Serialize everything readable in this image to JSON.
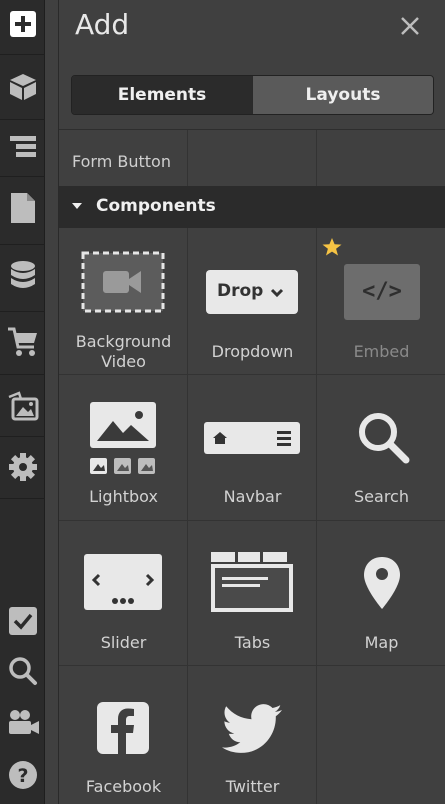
{
  "rail": {
    "items": [
      {
        "icon": "plus-square-icon"
      },
      {
        "icon": "box-icon"
      },
      {
        "icon": "navigator-icon"
      },
      {
        "icon": "page-icon"
      },
      {
        "icon": "database-icon"
      },
      {
        "icon": "cart-icon"
      },
      {
        "icon": "images-icon"
      },
      {
        "icon": "gear-icon"
      },
      {
        "icon": "checkbox-icon"
      },
      {
        "icon": "search-icon"
      },
      {
        "icon": "video-camera-icon"
      },
      {
        "icon": "help-icon"
      }
    ]
  },
  "panel": {
    "title": "Add",
    "close_icon": "close-icon",
    "tabs": [
      {
        "label": "Elements",
        "active": true
      },
      {
        "label": "Layouts",
        "active": false
      }
    ],
    "form_button_label": "Form Button",
    "section_title": "Components",
    "components": [
      {
        "label_line1": "Background",
        "label_line2": "Video",
        "icon": "background-video-icon"
      },
      {
        "label": "Dropdown",
        "icon": "dropdown-icon",
        "icon_text": "Drop"
      },
      {
        "label": "Embed",
        "icon": "embed-icon",
        "icon_text": "</>",
        "badge": "★"
      },
      {
        "label": "Lightbox",
        "icon": "lightbox-icon"
      },
      {
        "label": "Navbar",
        "icon": "navbar-icon"
      },
      {
        "label": "Search",
        "icon": "search-icon"
      },
      {
        "label": "Slider",
        "icon": "slider-icon"
      },
      {
        "label": "Tabs",
        "icon": "tabs-icon"
      },
      {
        "label": "Map",
        "icon": "map-pin-icon"
      },
      {
        "label": "Facebook",
        "icon": "facebook-icon"
      },
      {
        "label": "Twitter",
        "icon": "twitter-icon"
      }
    ]
  },
  "colors": {
    "background": "#404040",
    "rail": "#2b2b2b",
    "section_bar": "#2b2b2b",
    "icon_light": "#d9d9d9",
    "star": "#f5c344"
  }
}
